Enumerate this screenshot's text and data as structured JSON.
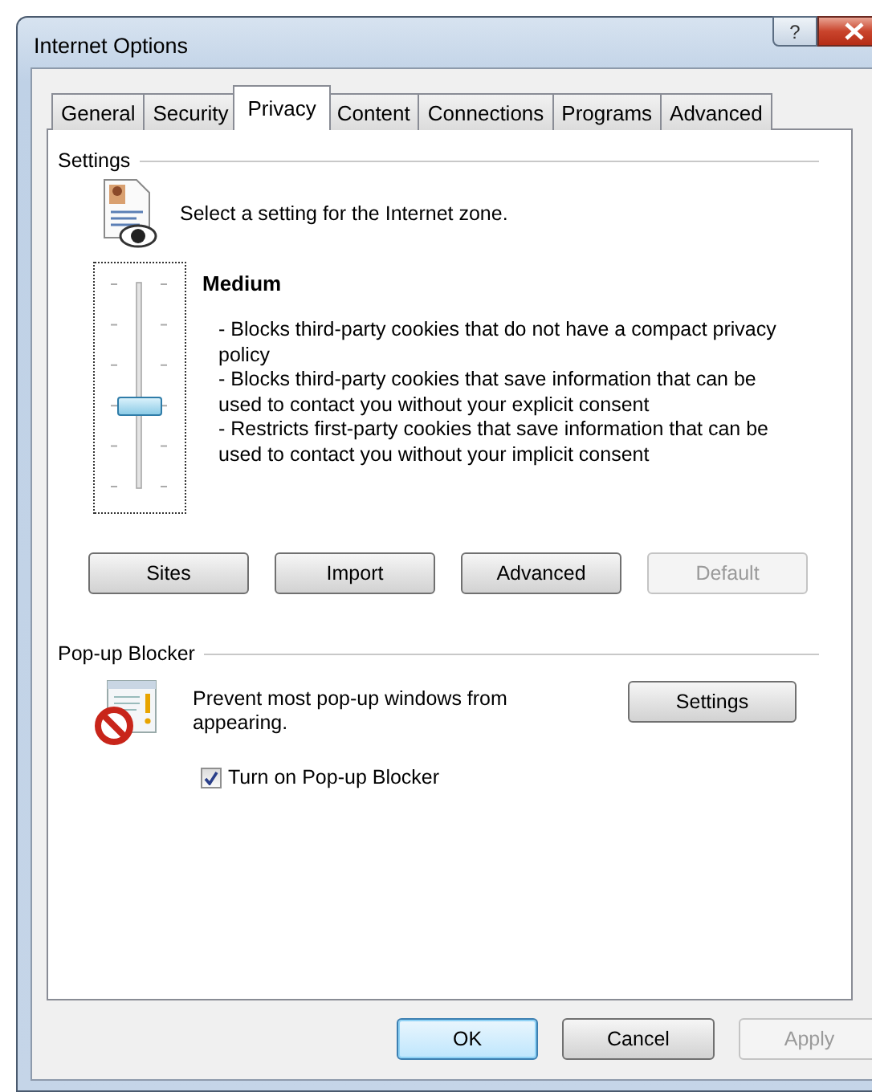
{
  "window": {
    "title": "Internet Options",
    "help_label": "?"
  },
  "tabs": [
    {
      "label": "General",
      "selected": false
    },
    {
      "label": "Security",
      "selected": false
    },
    {
      "label": "Privacy",
      "selected": true
    },
    {
      "label": "Content",
      "selected": false
    },
    {
      "label": "Connections",
      "selected": false
    },
    {
      "label": "Programs",
      "selected": false
    },
    {
      "label": "Advanced",
      "selected": false
    }
  ],
  "settings": {
    "heading": "Settings",
    "intro": "Select a setting for the Internet zone.",
    "slider": {
      "level": 0.4
    },
    "level_name": "Medium",
    "description": [
      "- Blocks third-party cookies that do not have a compact privacy policy",
      "- Blocks third-party cookies that save information that can be used to contact you without your explicit consent",
      "- Restricts first-party cookies that save information that can be used to contact you without your implicit consent"
    ],
    "buttons": [
      {
        "label": "Sites",
        "disabled": false
      },
      {
        "label": "Import",
        "disabled": false
      },
      {
        "label": "Advanced",
        "disabled": false
      },
      {
        "label": "Default",
        "disabled": true
      }
    ]
  },
  "popup_blocker": {
    "heading": "Pop-up Blocker",
    "text": "Prevent most pop-up windows from appearing.",
    "settings_button": "Settings",
    "checkbox": {
      "label": "Turn on Pop-up Blocker",
      "checked": true
    }
  },
  "dialog_buttons": [
    {
      "label": "OK",
      "default": true,
      "disabled": false
    },
    {
      "label": "Cancel",
      "default": false,
      "disabled": false
    },
    {
      "label": "Apply",
      "default": false,
      "disabled": true
    }
  ]
}
